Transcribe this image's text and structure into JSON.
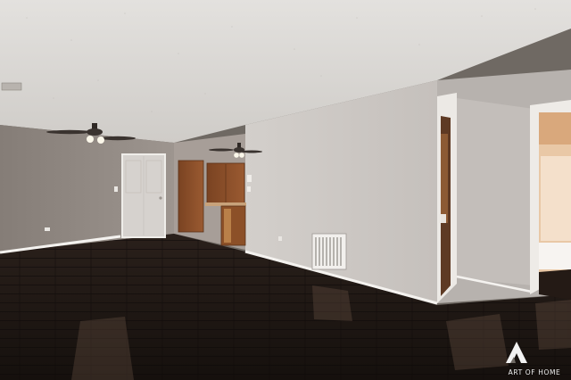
{
  "scene": {
    "description_free": true,
    "colors": {
      "ceiling": "#d9d6d2",
      "wall_left": "#8e8680",
      "wall_right": "#c9c4c0",
      "wall_far": "#a59c96",
      "floor_dark": "#1e1815",
      "floor_light": "#3a2c24",
      "baseboard": "#f3f1ee",
      "wood_door": "#8a4f2a",
      "white_door": "#d7d3cf"
    }
  },
  "watermark": {
    "logo_icon": "art-of-home-logo-icon",
    "text": "ART OF HOME"
  }
}
